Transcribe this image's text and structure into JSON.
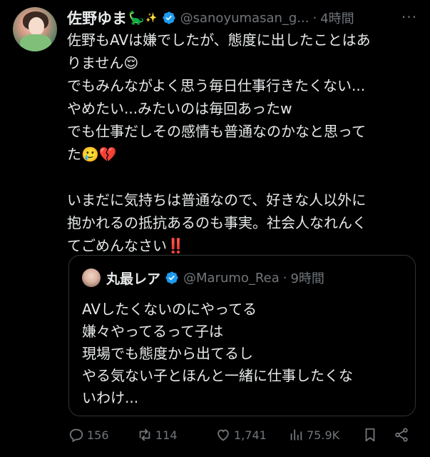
{
  "author": {
    "name": "佐野ゆま",
    "name_emoji": "🦕",
    "name_emoji2": "✨",
    "handle": "@sanoyumasan_g...",
    "separator": "·",
    "time": "4時間"
  },
  "more_label": "···",
  "tweet_lines": [
    "佐野もAVは嫌でしたが、態度に出したことはあ",
    "りません😌",
    "でもみんながよく思う毎日仕事行きたくない...",
    "やめたい...みたいのは毎回あったw",
    "でも仕事だしその感情も普通なのかなと思って",
    "た🥲💔",
    "",
    "いまだに気持ちは普通なので、好きな人以外に",
    "抱かれるの抵抗あるのも事実。社会人なれんく",
    "てごめんなさい‼️"
  ],
  "quote": {
    "name": "丸最レア",
    "handle": "@Marumo_Rea",
    "separator": "·",
    "time": "9時間",
    "lines": [
      "AVしたくないのにやってる",
      "嫌々やってるって子は",
      "現場でも態度から出てるし",
      "やる気ない子とほんと一緒に仕事したくな",
      "いわけ..."
    ]
  },
  "actions": {
    "replies": "156",
    "reposts": "114",
    "likes": "1,741",
    "views": "75.9K"
  },
  "colors": {
    "background": "#000000",
    "text": "#e7e9ea",
    "muted": "#71767b",
    "verified": "#1d9bf0",
    "border": "#2f3336"
  }
}
